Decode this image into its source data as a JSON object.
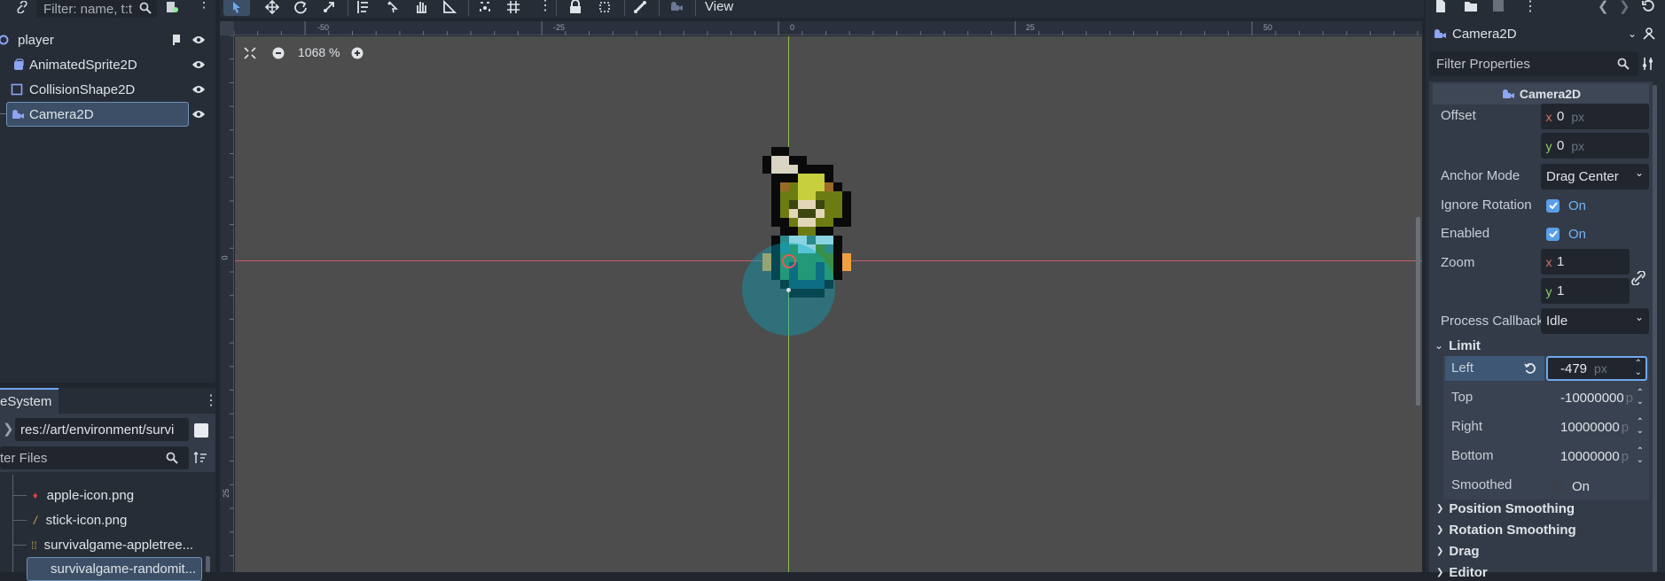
{
  "scene_dock": {
    "filter_placeholder": "Filter: name, t:t",
    "tree": [
      {
        "label": "player",
        "icon": "node2d-icon"
      },
      {
        "label": "AnimatedSprite2D",
        "icon": "animated-sprite-icon"
      },
      {
        "label": "CollisionShape2D",
        "icon": "collision-shape-icon"
      },
      {
        "label": "Camera2D",
        "icon": "camera2d-icon",
        "selected": true
      }
    ]
  },
  "filesystem_dock": {
    "title": "eSystem",
    "path": "res://art/environment/survi",
    "filter_placeholder": "ter Files",
    "files": [
      {
        "label": "apple-icon.png"
      },
      {
        "label": "stick-icon.png"
      },
      {
        "label": "survivalgame-appletree..."
      },
      {
        "label": "survivalgame-randomit...",
        "selected": true
      }
    ]
  },
  "viewport": {
    "toolbar": {
      "view_menu": "View"
    },
    "zoom_label": "1068 %",
    "ruler_ticks": [
      "-50",
      "-25",
      "0",
      "25",
      "50"
    ],
    "vruler_ticks": [
      "0",
      "25"
    ]
  },
  "inspector": {
    "object_name": "Camera2D",
    "filter_placeholder": "Filter Properties",
    "class_header": "Camera2D",
    "offset": {
      "label": "Offset",
      "x": "0",
      "y": "0",
      "unit": "px"
    },
    "anchor_mode": {
      "label": "Anchor Mode",
      "value": "Drag Center"
    },
    "ignore_rotation": {
      "label": "Ignore Rotation",
      "value": "On"
    },
    "enabled": {
      "label": "Enabled",
      "value": "On"
    },
    "zoom": {
      "label": "Zoom",
      "x": "1",
      "y": "1"
    },
    "process_callback": {
      "label": "Process Callback",
      "value": "Idle"
    },
    "limit": {
      "section": "Limit",
      "left": {
        "label": "Left",
        "value": "-479",
        "unit": "px"
      },
      "top": {
        "label": "Top",
        "value": "-10000000",
        "unit": "p"
      },
      "right": {
        "label": "Right",
        "value": "10000000",
        "unit": "p"
      },
      "bottom": {
        "label": "Bottom",
        "value": "10000000",
        "unit": "p"
      },
      "smoothed": {
        "label": "Smoothed",
        "value": "On"
      }
    },
    "sections": [
      "Position Smoothing",
      "Rotation Smoothing",
      "Drag",
      "Editor"
    ]
  }
}
